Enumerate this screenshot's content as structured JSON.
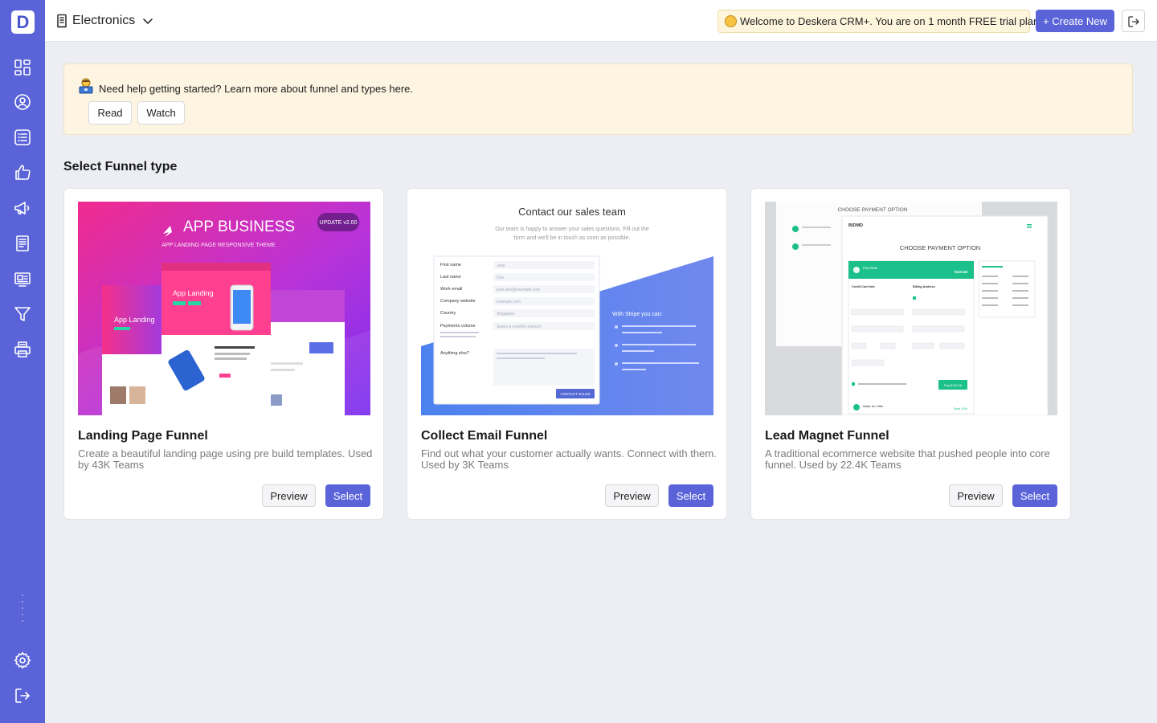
{
  "sidebar": {
    "logo_letter": "D",
    "items": [
      {
        "icon": "dashboard-icon"
      },
      {
        "icon": "contacts-icon"
      },
      {
        "icon": "list-icon"
      },
      {
        "icon": "thumbs-up-icon"
      },
      {
        "icon": "megaphone-icon"
      },
      {
        "icon": "document-icon"
      },
      {
        "icon": "newspaper-icon"
      },
      {
        "icon": "funnel-icon"
      },
      {
        "icon": "printer-icon"
      }
    ],
    "bottom": [
      {
        "icon": "gear-icon"
      },
      {
        "icon": "logout-icon"
      }
    ]
  },
  "header": {
    "org_name": "Electronics",
    "trial_text": "Welcome to Deskera CRM+. You are on 1 month FREE trial plan.",
    "create_new_label": "+ Create New"
  },
  "banner": {
    "text": "Need help getting started? Learn more about funnel and types here.",
    "read_label": "Read",
    "watch_label": "Watch"
  },
  "section_title": "Select Funnel type",
  "cards": [
    {
      "title": "Landing Page Funnel",
      "description": "Create a beautiful landing page using pre build templates. Used by 43K Teams",
      "preview_label": "Preview",
      "select_label": "Select",
      "thumb": {
        "brand": "APP BUSINESS",
        "tagline": "APP LANDING PAGE RESPONSIVE THEME",
        "badge": "UPDATE v2.00",
        "screen_title": "App Landing"
      }
    },
    {
      "title": "Collect Email Funnel",
      "description": "Find out what your customer actually wants. Connect with them. Used by 3K Teams",
      "preview_label": "Preview",
      "select_label": "Select",
      "thumb": {
        "heading": "Contact our sales team",
        "subheading_1": "Our team is happy to answer your sales questions. Fill out the",
        "subheading_2": "form and we'll be in touch as soon as possible.",
        "fields": [
          "First name",
          "Last name",
          "Work email",
          "Company website",
          "Country",
          "Payments volume",
          "Anything else?"
        ],
        "placeholders": [
          "Jane",
          "Doe",
          "jane.doe@example.com",
          "example.com",
          "Singapore",
          "Select a monthly amount",
          "Tell us more about your project, needs, and timeline."
        ],
        "button": "CONTACT SALES",
        "side_title": "With Stripe you can:",
        "side_items": [
          "Focus critical developer resources on your core business",
          "Launch new products faster with less payments code",
          "Improve conversion from international customers"
        ]
      }
    },
    {
      "title": "Lead Magnet Funnel",
      "description": "A traditional ecommerce website that pushed people into core funnel. Used by 22.4K Teams",
      "preview_label": "Preview",
      "select_label": "Select",
      "thumb": {
        "top_heading": "CHOOSE PAYMENT OPTION",
        "brand": "BIDMD",
        "heading": "CHOOSE PAYMENT OPTION",
        "pay_now": "Pay Now",
        "amount": "$119.46",
        "card_info": "Credit Card Info",
        "billing": "Billing Address",
        "pay_button": "Pay $119.46",
        "offer": "Make an Offer",
        "save": "Save 10%"
      }
    }
  ],
  "colors": {
    "sidebar": "#5a63d8",
    "accent": "#5a63d8",
    "banner_bg": "#fdf5e1",
    "page_bg": "#eceef3"
  }
}
